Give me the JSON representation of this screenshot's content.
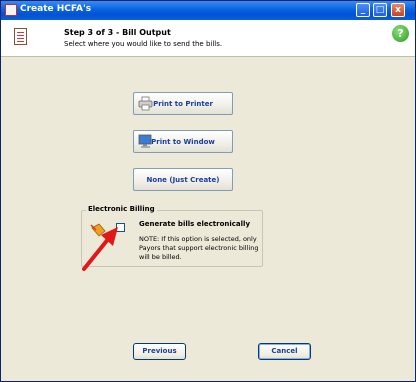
{
  "window": {
    "title": "Create HCFA's"
  },
  "header": {
    "step": "Step 3 of 3 - Bill Output",
    "subtitle": "Select where you would like to send the bills.",
    "help_label": "?"
  },
  "controls": {
    "minimize": "_",
    "maximize": "□",
    "close": "x"
  },
  "output_buttons": {
    "printer": {
      "label": "Print to Printer",
      "icon": "printer-icon"
    },
    "window": {
      "label": "Print to Window",
      "icon": "monitor-icon"
    },
    "none": {
      "label": "None (Just Create)"
    }
  },
  "electronic_billing": {
    "legend": "Electronic Billing",
    "checkbox_label": "Generate bills electronically",
    "checked": false,
    "note": "NOTE: If this option is selected, only Payors that support electronic billing will be billed."
  },
  "footer": {
    "previous": "Previous",
    "cancel": "Cancel"
  },
  "colors": {
    "title_bar": "#0a62e0",
    "button_text": "#1a3ea0",
    "annotation_arrow": "#e01818"
  }
}
